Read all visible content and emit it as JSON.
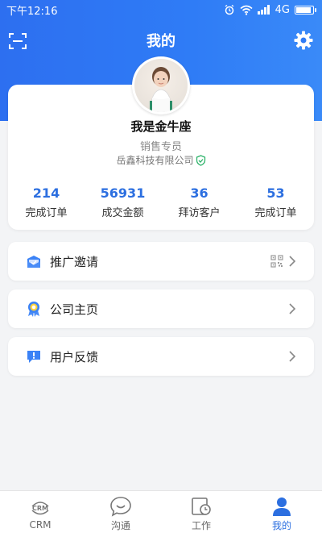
{
  "status_bar": {
    "time": "下午12:16",
    "network": "4G"
  },
  "header": {
    "title": "我的"
  },
  "profile": {
    "name": "我是金牛座",
    "role": "销售专员",
    "company": "岳鑫科技有限公司"
  },
  "stats": [
    {
      "value": "214",
      "label": "完成订单"
    },
    {
      "value": "56931",
      "label": "成交金额"
    },
    {
      "value": "36",
      "label": "拜访客户"
    },
    {
      "value": "53",
      "label": "完成订单"
    }
  ],
  "menu": [
    {
      "label": "推广邀请",
      "icon": "envelope-icon"
    },
    {
      "label": "公司主页",
      "icon": "badge-icon"
    },
    {
      "label": "用户反馈",
      "icon": "feedback-icon"
    }
  ],
  "nav": [
    {
      "label": "CRM",
      "icon_text": "CRM",
      "icon": "crm-icon",
      "active": false
    },
    {
      "label": "沟通",
      "icon": "chat-icon",
      "active": false
    },
    {
      "label": "工作",
      "icon": "work-icon",
      "active": false
    },
    {
      "label": "我的",
      "icon": "user-icon",
      "active": true
    }
  ],
  "colors": {
    "primary": "#2d6ff0",
    "accent_text": "#2c6fe0",
    "background": "#f3f4f6"
  }
}
